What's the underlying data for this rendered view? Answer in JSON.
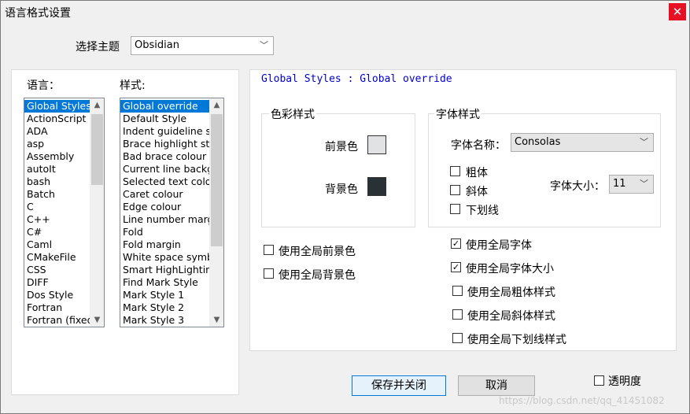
{
  "window": {
    "title": "语言格式设置",
    "close_glyph": "✕"
  },
  "theme": {
    "label": "选择主题",
    "value": "Obsidian"
  },
  "languages": {
    "label": "语言：",
    "items": [
      "Global Styles",
      "ActionScript",
      "ADA",
      "asp",
      "Assembly",
      "autoIt",
      "bash",
      "Batch",
      "C",
      "C++",
      "C#",
      "Caml",
      "CMakeFile",
      "CSS",
      "DIFF",
      "Dos Style",
      "Fortran",
      "Fortran (fixed"
    ],
    "selected_index": 0
  },
  "styles": {
    "label": "样式:",
    "items": [
      "Global override",
      "Default Style",
      "Indent guideline st",
      "Brace highlight styl",
      "Bad brace colour",
      "Current line backgr",
      "Selected text colou",
      "Caret colour",
      "Edge colour",
      "Line number marg",
      "Fold",
      "Fold margin",
      "White space symbo",
      "Smart HighLighting",
      "Find Mark Style",
      "Mark Style 1",
      "Mark Style 2",
      "Mark Style 3"
    ],
    "selected_index": 0
  },
  "style_header": "Global Styles : Global override",
  "color_group": {
    "title": "色彩样式",
    "fg_label": "前景色",
    "fg_color": "#e0e2e4",
    "bg_label": "背景色",
    "bg_color": "#293134"
  },
  "font_group": {
    "title": "字体样式",
    "name_label": "字体名称：",
    "name_value": "Consolas",
    "size_label": "字体大小：",
    "size_value": "11",
    "bold_label": "粗体",
    "italic_label": "斜体",
    "underline_label": "下划线"
  },
  "global_checks": {
    "global_fg": "使用全局前景色",
    "global_bg": "使用全局背景色",
    "global_font": "使用全局字体",
    "global_font_size": "使用全局字体大小",
    "global_bold": "使用全局粗体样式",
    "global_italic": "使用全局斜体样式",
    "global_underline": "使用全局下划线样式"
  },
  "buttons": {
    "save_close": "保存并关闭",
    "cancel": "取消"
  },
  "transparency_label": "透明度",
  "watermark": "https://blog.csdn.net/qq_41451082"
}
